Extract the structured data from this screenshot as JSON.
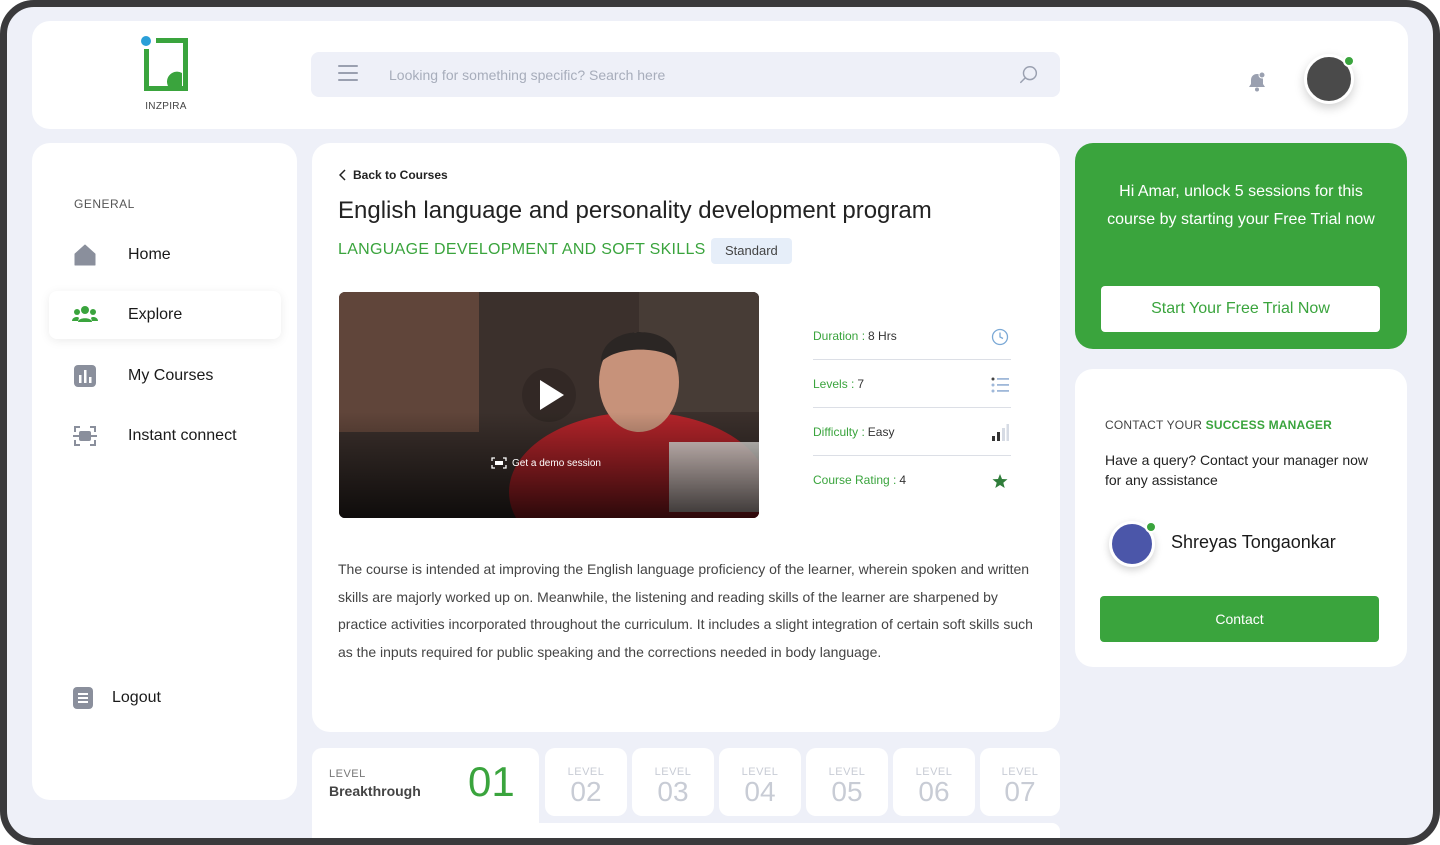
{
  "brand": {
    "logo_text": "INZPIRA",
    "accent": "#3aa43d",
    "secondary": "#4b56a9"
  },
  "header": {
    "search_placeholder": "Looking for something specific? Search here",
    "icons": [
      "menu-icon",
      "search-icon",
      "bell-icon"
    ]
  },
  "sidebar": {
    "section_label": "GENERAL",
    "items": [
      {
        "label": "Home",
        "icon": "home-icon"
      },
      {
        "label": "Explore",
        "icon": "users-icon",
        "active": true
      },
      {
        "label": "My Courses",
        "icon": "chart-icon"
      },
      {
        "label": "Instant connect",
        "icon": "scan-icon"
      }
    ],
    "logout_label": "Logout"
  },
  "course": {
    "back_label": "Back to Courses",
    "title": "English language and personality development program",
    "category": "LANGUAGE DEVELOPMENT AND SOFT SKILLS",
    "badge": "Standard",
    "demo_label": "Get a demo session",
    "stats": [
      {
        "key": "Duration :",
        "value": "8 Hrs",
        "icon": "clock-icon"
      },
      {
        "key": "Levels :",
        "value": "7",
        "icon": "list-icon"
      },
      {
        "key": "Difficulty :",
        "value": "Easy",
        "icon": "signal-icon"
      },
      {
        "key": "Course Rating :",
        "value": "4",
        "icon": "star-icon"
      }
    ],
    "description": "The course is intended at improving the English language proficiency of the learner, wherein spoken and written skills are majorly worked up on. Meanwhile, the listening and reading skills of the learner are sharpened by practice activities incorporated throughout the curriculum. It includes a slight integration of certain soft skills such as the inputs required for public speaking and the corrections needed in body language."
  },
  "levels": {
    "active": {
      "label": "LEVEL",
      "name": "Breakthrough",
      "number": "01"
    },
    "tabs": [
      {
        "label": "LEVEL",
        "number": "02"
      },
      {
        "label": "LEVEL",
        "number": "03"
      },
      {
        "label": "LEVEL",
        "number": "04"
      },
      {
        "label": "LEVEL",
        "number": "05"
      },
      {
        "label": "LEVEL",
        "number": "06"
      },
      {
        "label": "LEVEL",
        "number": "07"
      }
    ]
  },
  "trial": {
    "text": "Hi Amar, unlock 5 sessions for this course by starting your Free Trial now",
    "button_label": "Start Your Free Trial Now"
  },
  "contact": {
    "heading_prefix": "CONTACT YOUR",
    "heading_highlight": "SUCCESS MANAGER",
    "description": "Have a query? Contact your manager now for any assistance",
    "manager_name": "Shreyas Tongaonkar",
    "button_label": "Contact"
  }
}
